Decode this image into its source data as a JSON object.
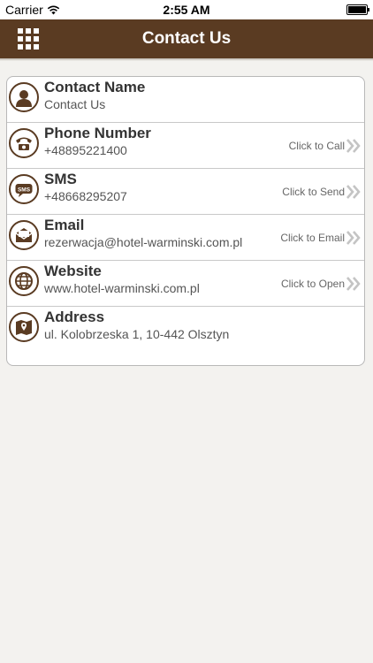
{
  "status_bar": {
    "carrier": "Carrier",
    "time": "2:55 AM",
    "wifi_icon": "wifi-icon",
    "battery_icon": "battery-icon"
  },
  "nav": {
    "title": "Contact Us",
    "menu_icon": "grid-menu-icon",
    "color": "#5a3b22"
  },
  "rows": [
    {
      "icon": "person-icon",
      "title": "Contact Name",
      "value": "Contact Us",
      "action": ""
    },
    {
      "icon": "phone-icon",
      "title": "Phone Number",
      "value": "+48895221400",
      "action": "Click to Call"
    },
    {
      "icon": "sms-icon",
      "title": "SMS",
      "value": "+48668295207",
      "action": "Click to Send"
    },
    {
      "icon": "envelope-icon",
      "title": "Email",
      "value": "rezerwacja@hotel-warminski.com.pl",
      "action": "Click to Email"
    },
    {
      "icon": "globe-icon",
      "title": "Website",
      "value": "www.hotel-warminski.com.pl",
      "action": "Click to Open"
    },
    {
      "icon": "map-pin-icon",
      "title": "Address",
      "value": "ul. Kolobrzeska 1, 10-442 Olsztyn",
      "action": ""
    }
  ]
}
